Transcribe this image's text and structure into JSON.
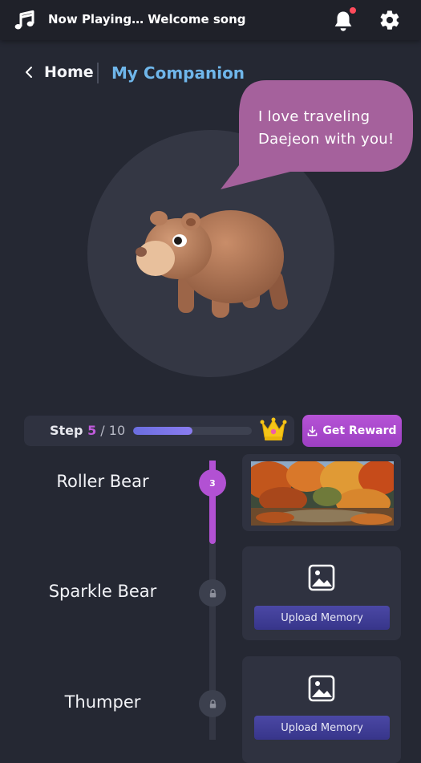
{
  "topbar": {
    "now_playing": "Now Playing… Welcome song",
    "music_icon": "music-note-icon",
    "bell_icon": "bell-icon",
    "settings_icon": "gear-icon",
    "notification_dot_color": "#ff4b5c"
  },
  "breadcrumb": {
    "home": "Home",
    "current": "My Companion"
  },
  "companion": {
    "speech": "I love traveling Daejeon with you!",
    "speech_bubble_color": "#a5619c"
  },
  "progress": {
    "step_label": "Step",
    "current": "5",
    "separator": " / ",
    "total": "10",
    "fraction": 0.5,
    "reward_label": "Get Reward",
    "crown_icon": "crown-icon"
  },
  "timeline": {
    "items": [
      {
        "name": "Roller Bear",
        "node": "3",
        "state": "active"
      },
      {
        "name": "Sparkle Bear",
        "node": "",
        "state": "locked",
        "upload_label": "Upload Memory"
      },
      {
        "name": "Thumper",
        "node": "",
        "state": "locked",
        "upload_label": "Upload Memory"
      }
    ],
    "accent": "#b251d3"
  }
}
